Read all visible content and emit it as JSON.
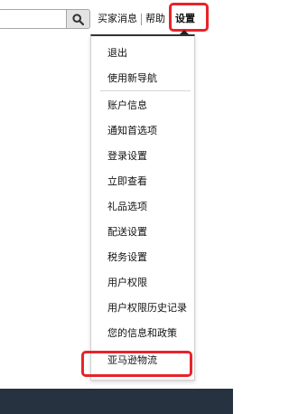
{
  "header": {
    "search_icon": "search-icon",
    "links": {
      "buyer_messages": "买家消息",
      "help": "帮助",
      "settings": "设置"
    }
  },
  "settings_menu": {
    "items": [
      "退出",
      "使用新导航",
      "账户信息",
      "通知首选项",
      "登录设置",
      "立即查看",
      "礼品选项",
      "配送设置",
      "税务设置",
      "用户权限",
      "用户权限历史记录",
      "您的信息和政策",
      "亚马逊物流"
    ]
  },
  "colors": {
    "highlight": "#e8232a",
    "footer": "#263240"
  }
}
